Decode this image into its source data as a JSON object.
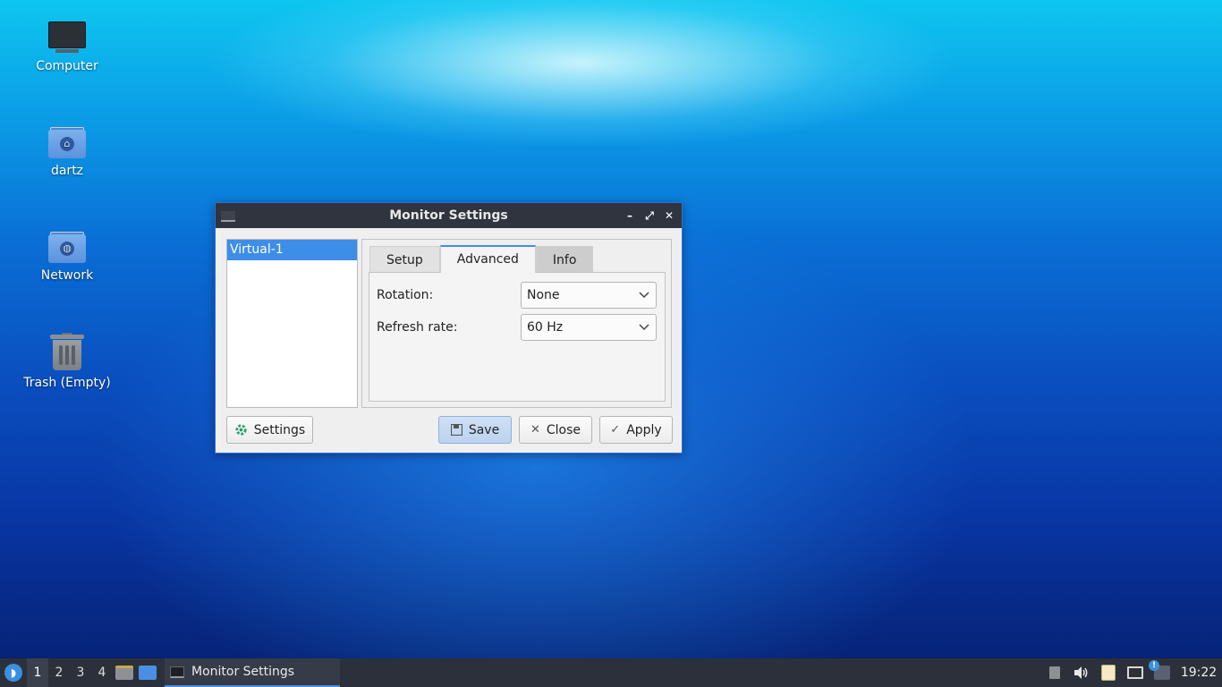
{
  "desktop": {
    "icons": [
      {
        "label": "Computer",
        "icon": "computer-icon"
      },
      {
        "label": "dartz",
        "icon": "home-folder-icon"
      },
      {
        "label": "Network",
        "icon": "network-folder-icon"
      },
      {
        "label": "Trash (Empty)",
        "icon": "trash-icon"
      }
    ]
  },
  "window": {
    "title": "Monitor Settings",
    "controls": {
      "minimize": "minimize-icon",
      "maximize": "maximize-icon",
      "close": "close-icon"
    },
    "monitors": [
      "Virtual-1"
    ],
    "tabs": [
      "Setup",
      "Advanced",
      "Info"
    ],
    "active_tab": "Advanced",
    "fields": {
      "rotation": {
        "label": "Rotation:",
        "value": "None"
      },
      "refresh_rate": {
        "label": "Refresh rate:",
        "value": "60 Hz"
      }
    },
    "buttons": {
      "settings": "Settings",
      "save": "Save",
      "close": "Close",
      "apply": "Apply"
    }
  },
  "taskbar": {
    "workspaces": [
      "1",
      "2",
      "3",
      "4"
    ],
    "active_workspace": "1",
    "task_label": "Monitor Settings",
    "clock": "19:22"
  },
  "colors": {
    "accent": "#3d8ee8",
    "titlebar": "#2f343f",
    "taskbar": "#2b303a"
  }
}
